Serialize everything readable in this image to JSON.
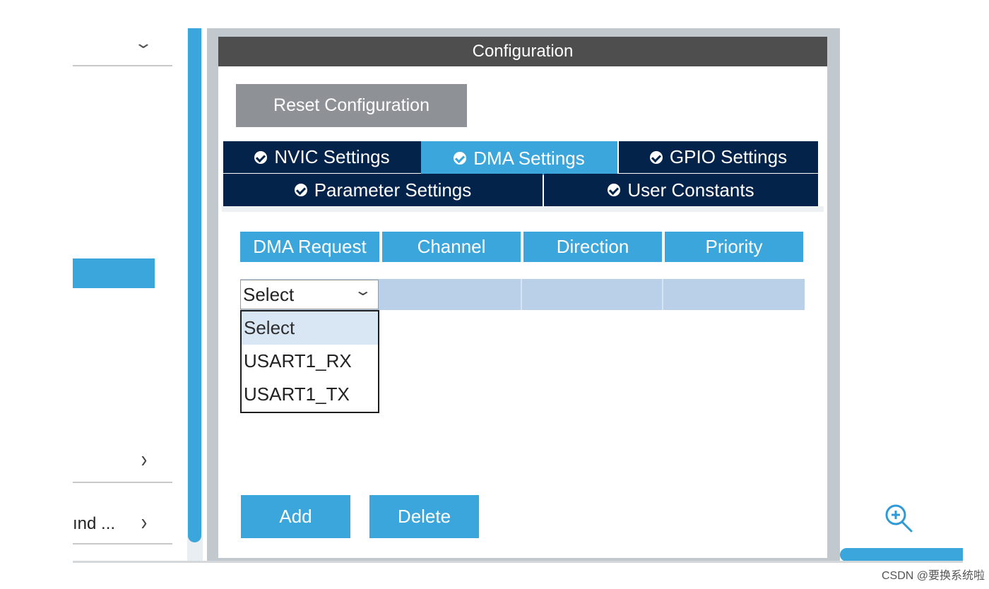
{
  "sidebar": {
    "truncated_label": "ınd ..."
  },
  "panel": {
    "title": "Configuration",
    "reset_label": "Reset Configuration"
  },
  "tabs": [
    {
      "label": "NVIC Settings",
      "active": false
    },
    {
      "label": "DMA Settings",
      "active": true
    },
    {
      "label": "GPIO Settings",
      "active": false
    },
    {
      "label": "Parameter Settings",
      "active": false
    },
    {
      "label": "User Constants",
      "active": false
    }
  ],
  "dma_table": {
    "columns": [
      "DMA Request",
      "Channel",
      "Direction",
      "Priority"
    ],
    "select": {
      "value": "Select",
      "options": [
        "Select",
        "USART1_RX",
        "USART1_TX"
      ]
    }
  },
  "actions": {
    "add_label": "Add",
    "delete_label": "Delete"
  },
  "watermark": "CSDN @要换系统啦",
  "colors": {
    "accent": "#3aa6dc",
    "tab_bg": "#03234b",
    "header_bg": "#4e4e4e",
    "row_bg": "#b9d0e8"
  }
}
